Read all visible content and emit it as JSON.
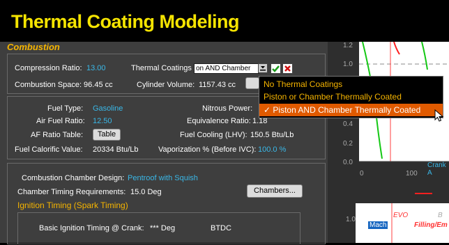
{
  "app_title": "Thermal Coating Modeling",
  "combustion": {
    "section_title": "Combustion",
    "compression_ratio_label": "Compression Ratio:",
    "compression_ratio_value": "13.00",
    "thermal_coatings_label": "Thermal Coatings",
    "thermal_coatings_value": "on AND Chamber",
    "combustion_space_label": "Combustion Space: 96.45 cc",
    "cylinder_volume_label": "Cylinder Volume:",
    "cylinder_volume_value": "1157.43 cc"
  },
  "dropdown": {
    "options": [
      "No Thermal Coatings",
      "Piston or Chamber Thermally Coated",
      "Piston AND Chamber Thermally Coated"
    ],
    "selected_index": 2,
    "checkmark": "✓"
  },
  "fuel": {
    "fuel_type_label": "Fuel Type:",
    "fuel_type_value": "Gasoline",
    "nitrous_power_label": "Nitrous Power:",
    "air_fuel_ratio_label": "Air Fuel Ratio:",
    "air_fuel_ratio_value": "12.50",
    "equivalence_ratio_label": "Equivalence Ratio:",
    "equivalence_ratio_value": "1.18",
    "af_ratio_table_label": "AF Ratio Table:",
    "af_ratio_table_button": "Table",
    "fuel_cooling_label": "Fuel Cooling (LHV):",
    "fuel_cooling_value": "150.5 Btu/Lb",
    "fuel_calorific_label": "Fuel Calorific Value:",
    "fuel_calorific_value": "20334 Btu/Lb",
    "vaporization_label": "Vaporization % (Before IVC):",
    "vaporization_value": "100.0 %"
  },
  "chamber": {
    "design_label": "Combustion Chamber Design:",
    "design_value": "Pentroof with Squish",
    "timing_req_label": "Chamber Timing Requirements:",
    "timing_req_value": "15.0 Deg",
    "chambers_button": "Chambers..."
  },
  "ignition": {
    "title": "Ignition Timing (Spark Timing)",
    "basic_label": "Basic Ignition Timing @ Crank:",
    "basic_value": "*** Deg",
    "basic_unit": "BTDC"
  },
  "chart_top": {
    "y_ticks": [
      "1.2",
      "1.0",
      "0.4",
      "0.2",
      "0.0"
    ],
    "x_ticks": [
      "0",
      "100"
    ],
    "x_label": "Crank A"
  },
  "chart_bottom": {
    "y_tick": "1.0",
    "mach_label": "Mach",
    "evo_label": "EVO",
    "filling_label": "Filling/Em",
    "b_label": "B"
  }
}
